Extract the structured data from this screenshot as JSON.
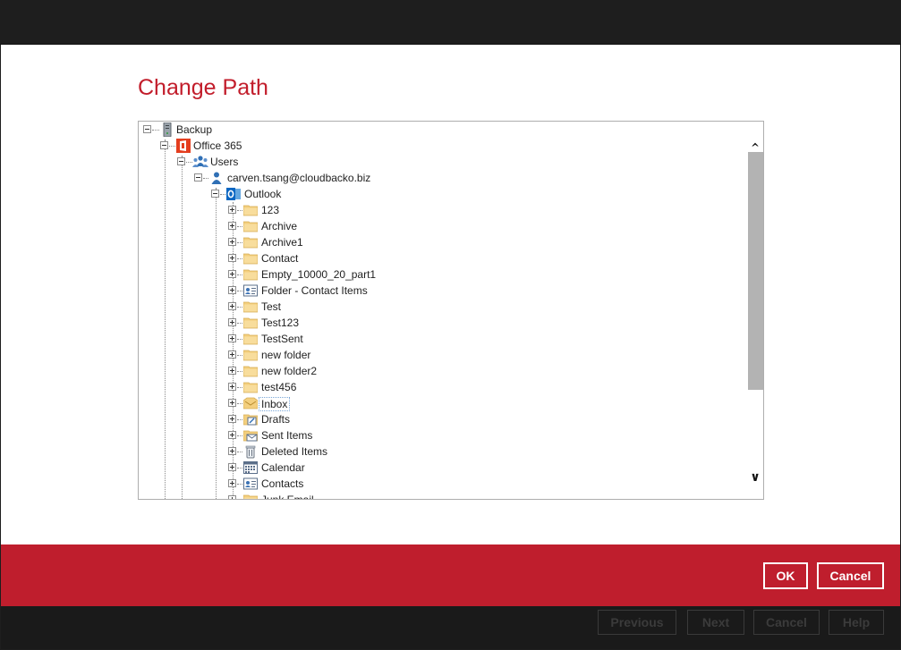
{
  "dialog": {
    "title": "Change Path",
    "ok_label": "OK",
    "cancel_label": "Cancel"
  },
  "tree": {
    "root": "Backup",
    "office": "Office 365",
    "users": "Users",
    "user": "carven.tsang@cloudbacko.biz",
    "outlook": "Outlook",
    "folders": [
      {
        "label": "123",
        "icon": "folder-icon"
      },
      {
        "label": "Archive",
        "icon": "folder-icon"
      },
      {
        "label": "Archive1",
        "icon": "folder-icon"
      },
      {
        "label": "Contact",
        "icon": "folder-icon"
      },
      {
        "label": "Empty_10000_20_part1",
        "icon": "folder-icon"
      },
      {
        "label": "Folder - Contact Items",
        "icon": "contact-card-icon"
      },
      {
        "label": "Test",
        "icon": "folder-icon"
      },
      {
        "label": "Test123",
        "icon": "folder-icon"
      },
      {
        "label": "TestSent",
        "icon": "folder-icon"
      },
      {
        "label": "new folder",
        "icon": "folder-icon"
      },
      {
        "label": "new folder2",
        "icon": "folder-icon"
      },
      {
        "label": "test456",
        "icon": "folder-icon"
      },
      {
        "label": "Inbox",
        "icon": "inbox-icon"
      },
      {
        "label": "Drafts",
        "icon": "drafts-icon"
      },
      {
        "label": "Sent Items",
        "icon": "sent-items-icon"
      },
      {
        "label": "Deleted Items",
        "icon": "trash-icon"
      },
      {
        "label": "Calendar",
        "icon": "calendar-icon"
      },
      {
        "label": "Contacts",
        "icon": "contact-card-icon"
      },
      {
        "label": "Junk Email",
        "icon": "folder-icon"
      }
    ],
    "selected": "Inbox"
  },
  "background_buttons": {
    "previous": "Previous",
    "next": "Next",
    "cancel": "Cancel",
    "help": "Help"
  },
  "colors": {
    "accent": "#bf1e2d",
    "title": "#c21d2b"
  }
}
